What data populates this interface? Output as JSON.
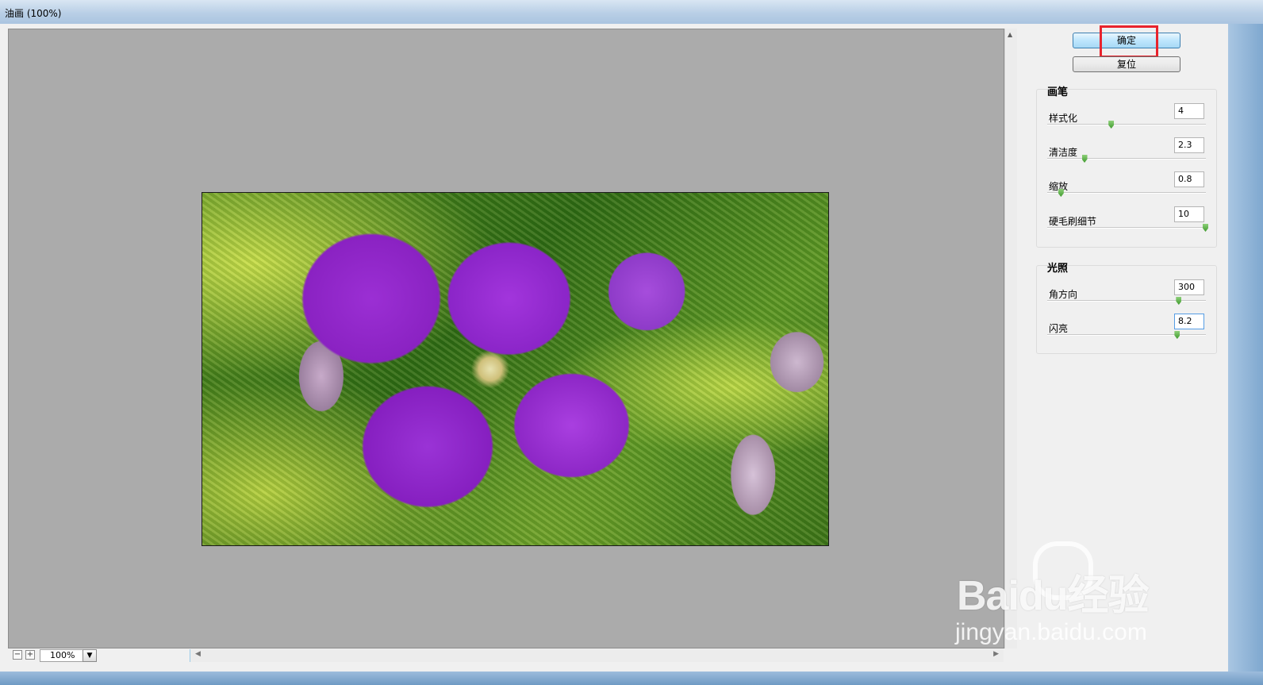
{
  "window": {
    "title": "油画 (100%)"
  },
  "buttons": {
    "ok_label": "确定",
    "reset_label": "复位"
  },
  "brush": {
    "title": "画笔",
    "sliders": [
      {
        "label": "样式化",
        "value": "4",
        "fraction": 0.4
      },
      {
        "label": "清洁度",
        "value": "2.3",
        "fraction": 0.23
      },
      {
        "label": "缩放",
        "value": "0.8",
        "fraction": 0.08
      },
      {
        "label": "硬毛刷细节",
        "value": "10",
        "fraction": 1.0
      }
    ]
  },
  "lighting": {
    "title": "光照",
    "sliders": [
      {
        "label": "角方向",
        "value": "300",
        "fraction": 0.83
      },
      {
        "label": "闪亮",
        "value": "8.2",
        "fraction": 0.82
      }
    ]
  },
  "zoom": {
    "value": "100%",
    "minus": "−",
    "plus": "+"
  },
  "watermark": {
    "logo": "Baidu经验",
    "url": "jingyan.baidu.com"
  }
}
